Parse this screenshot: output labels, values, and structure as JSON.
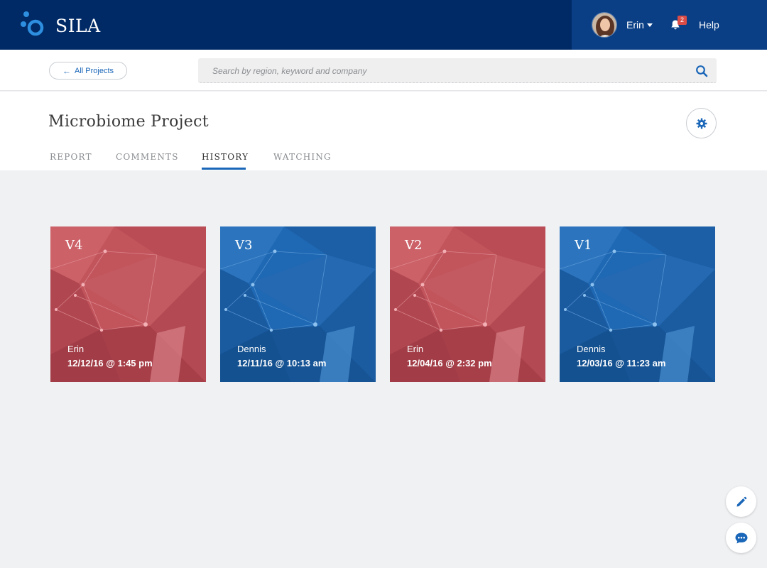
{
  "colors": {
    "nav_bg": "#002a66",
    "nav_right_bg": "#0a3f86",
    "accent": "#1a66b8",
    "card_red": "#c2545c",
    "card_blue": "#1f68b3",
    "badge": "#d94c47"
  },
  "nav": {
    "brand": "SILA",
    "logo_icon": "sila-logo-icon",
    "user_name": "Erin",
    "notification_count": "2",
    "help": "Help"
  },
  "subbar": {
    "back_label": "All Projects",
    "search_placeholder": "Search by region, keyword and company"
  },
  "page": {
    "title": "Microbiome Project",
    "tabs": [
      {
        "label": "REPORT",
        "active": false
      },
      {
        "label": "COMMENTS",
        "active": false
      },
      {
        "label": "HISTORY",
        "active": true
      },
      {
        "label": "WATCHING",
        "active": false
      }
    ]
  },
  "versions": [
    {
      "version": "V4",
      "author": "Erin",
      "date": "12/12/16 @ 1:45 pm",
      "theme": "red"
    },
    {
      "version": "V3",
      "author": "Dennis",
      "date": "12/11/16 @ 10:13 am",
      "theme": "blue"
    },
    {
      "version": "V2",
      "author": "Erin",
      "date": "12/04/16 @ 2:32 pm",
      "theme": "red"
    },
    {
      "version": "V1",
      "author": "Dennis",
      "date": "12/03/16 @ 11:23 am",
      "theme": "blue"
    }
  ],
  "floating_actions": [
    "edit-icon",
    "chat-icon"
  ]
}
